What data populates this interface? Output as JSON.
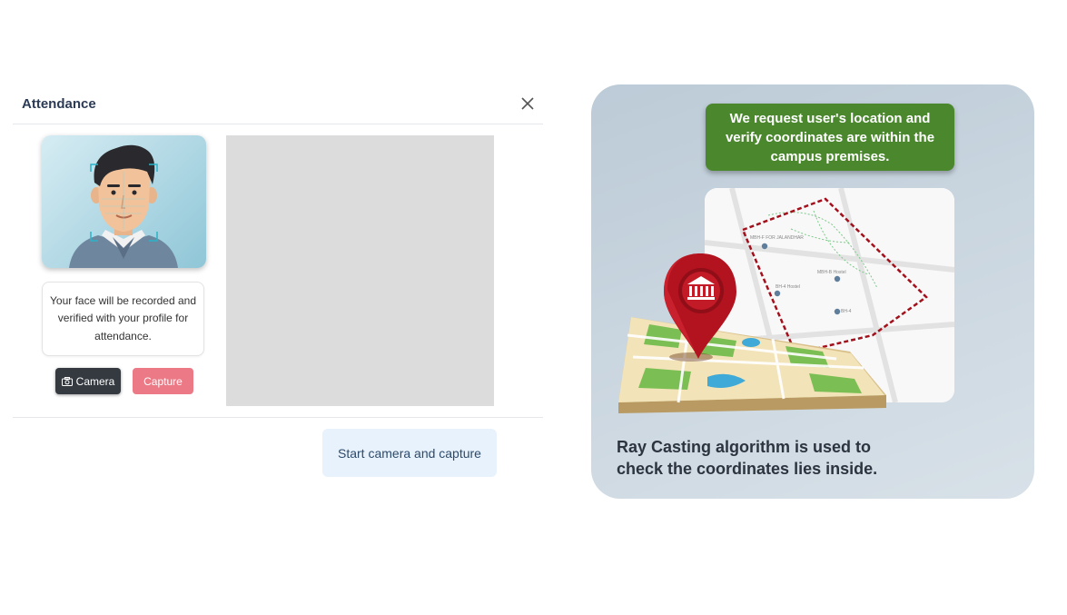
{
  "modal": {
    "title": "Attendance",
    "info_text": "Your face will be recorded and verified with your profile for attendance.",
    "camera_button": "Camera",
    "capture_button": "Capture",
    "start_button": "Start camera and capture",
    "icons": {
      "close": "close-icon",
      "camera": "camera-icon"
    }
  },
  "infographic": {
    "banner_text": "We request user's location and\nverify coordinates are within the\ncampus premises.",
    "bottom_text": "Ray Casting algorithm is used to\ncheck the coordinates lies inside.",
    "map_labels": [
      "MBH-F FOR JALANDHAR",
      "MBH-B Hostel",
      "BH-4 Hostel",
      "BH-4"
    ],
    "colors": {
      "banner": "#4a872d",
      "pin": "#b3121f",
      "boundary": "#a3101c"
    }
  }
}
